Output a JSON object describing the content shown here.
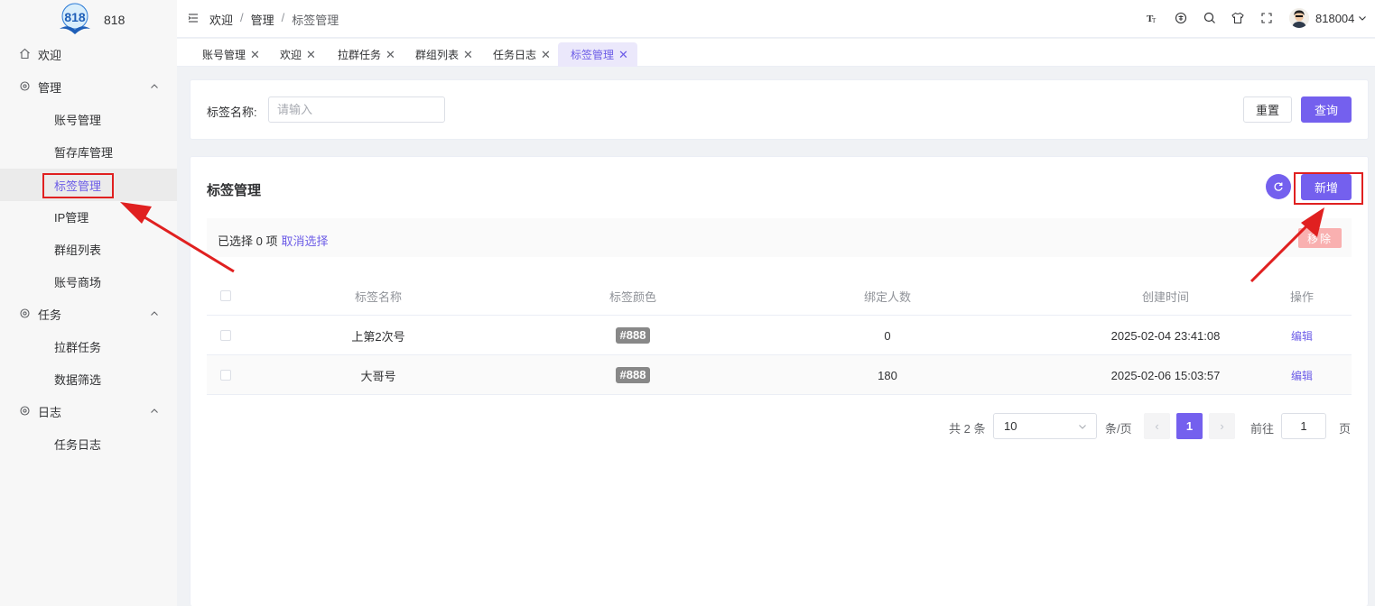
{
  "app": {
    "logo_text": "818",
    "logo_caption": "818"
  },
  "sidebar": {
    "items": [
      {
        "label": "欢迎",
        "icon": "home-icon"
      },
      {
        "label": "管理",
        "icon": "gear-icon",
        "expanded": true,
        "children": [
          "账号管理",
          "暂存库管理",
          "标签管理",
          "IP管理",
          "群组列表",
          "账号商场"
        ]
      },
      {
        "label": "任务",
        "icon": "gear-icon",
        "expanded": true,
        "children": [
          "拉群任务",
          "数据筛选"
        ]
      },
      {
        "label": "日志",
        "icon": "gear-icon",
        "expanded": true,
        "children": [
          "任务日志"
        ]
      }
    ],
    "active_item": "标签管理"
  },
  "header": {
    "breadcrumb": [
      "欢迎",
      "管理",
      "标签管理"
    ],
    "separator": "/",
    "username": "818004"
  },
  "tabs": [
    {
      "label": "账号管理",
      "active": false
    },
    {
      "label": "欢迎",
      "active": false
    },
    {
      "label": "拉群任务",
      "active": false
    },
    {
      "label": "群组列表",
      "active": false
    },
    {
      "label": "任务日志",
      "active": false
    },
    {
      "label": "标签管理",
      "active": true
    }
  ],
  "search": {
    "label": "标签名称:",
    "placeholder": "请输入",
    "value": "",
    "reset_label": "重置",
    "query_label": "查询"
  },
  "table_card": {
    "title": "标签管理",
    "add_label": "新增",
    "selection_text": "已选择 0 项",
    "cancel_selection": "取消选择",
    "delete_label": "移除",
    "columns": [
      "标签名称",
      "标签颜色",
      "绑定人数",
      "创建时间",
      "操作"
    ],
    "rows": [
      {
        "name": "上第2次号",
        "color": "#888",
        "count": "0",
        "created": "2025-02-04 23:41:08",
        "action": "编辑"
      },
      {
        "name": "大哥号",
        "color": "#888",
        "count": "180",
        "created": "2025-02-06 15:03:57",
        "action": "编辑"
      }
    ]
  },
  "pagination": {
    "total_text": "共 2 条",
    "page_size": "10",
    "per_page_suffix": "条/页",
    "current_page": "1",
    "goto_label": "前往",
    "goto_value": "1",
    "page_suffix": "页"
  },
  "colors": {
    "accent": "#7460ee",
    "annotation": "#e02020",
    "tag_bg": "#888888"
  }
}
